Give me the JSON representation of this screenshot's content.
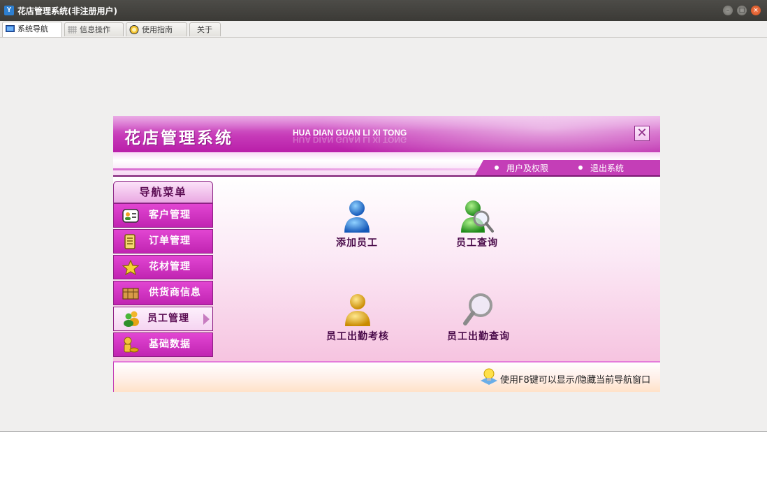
{
  "window": {
    "title": "花店管理系统(非注册用户)"
  },
  "tabs": [
    {
      "label": "系统导航",
      "icon": "monitor-icon"
    },
    {
      "label": "信息操作",
      "icon": "grid-icon"
    },
    {
      "label": "使用指南",
      "icon": "globe-icon"
    },
    {
      "label": "关于",
      "icon": ""
    }
  ],
  "banner": {
    "title": "花店管理系统",
    "pinyin": "HUA DIAN GUAN LI XI TONG"
  },
  "top_links": [
    "用户及权限",
    "退出系统"
  ],
  "nav": {
    "header": "导航菜单",
    "items": [
      {
        "label": "客户管理",
        "icon": "customer-card-icon"
      },
      {
        "label": "订单管理",
        "icon": "order-document-icon"
      },
      {
        "label": "花材管理",
        "icon": "star-icon"
      },
      {
        "label": "供货商信息",
        "icon": "supplier-box-icon"
      },
      {
        "label": "员工管理",
        "icon": "employees-icon"
      },
      {
        "label": "基础数据",
        "icon": "base-data-icon"
      }
    ],
    "active_index": 4
  },
  "functions": [
    {
      "label": "添加员工",
      "icon": "add-employee-icon"
    },
    {
      "label": "员工查询",
      "icon": "employee-search-icon"
    },
    {
      "label": "员工出勤考核",
      "icon": "attendance-review-icon"
    },
    {
      "label": "员工出勤查询",
      "icon": "magnifier-icon"
    }
  ],
  "footer": {
    "tip": "使用F8键可以显示/隐藏当前导航窗口"
  },
  "colors": {
    "accent": "#c63ab8",
    "nav_item": "#d435c4",
    "title_bar": "#3f3e3a"
  }
}
